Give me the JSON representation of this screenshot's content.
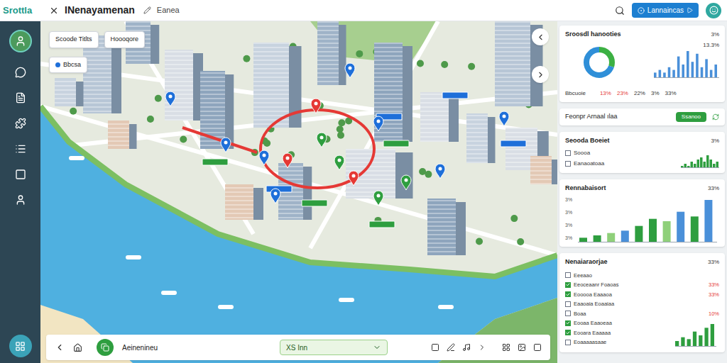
{
  "header": {
    "logo": "Srottla",
    "title": "INenayamenan",
    "subtitle": "Eanea",
    "button": "Lannaincas"
  },
  "map": {
    "chips": [
      "Scoode Titlts",
      "Hoooqore",
      "Bbcsa"
    ],
    "pins": [
      {
        "color": "#e53935"
      },
      {
        "color": "#1e6fd9"
      },
      {
        "color": "#1e6fd9"
      },
      {
        "color": "#e53935"
      },
      {
        "color": "#1e6fd9"
      },
      {
        "color": "#2e9e3f"
      },
      {
        "color": "#2e9e3f"
      },
      {
        "color": "#e53935"
      },
      {
        "color": "#2e9e3f"
      },
      {
        "color": "#1e6fd9"
      },
      {
        "color": "#1e6fd9"
      },
      {
        "color": "#2e9e3f"
      },
      {
        "color": "#1e6fd9"
      },
      {
        "color": "#1e6fd9"
      },
      {
        "color": "#1e6fd9"
      }
    ],
    "tags": [
      {
        "color": "#1e6fd9"
      },
      {
        "color": "#1e6fd9"
      },
      {
        "color": "#1e6fd9"
      },
      {
        "color": "#1e6fd9"
      },
      {
        "color": "#2e9e3f"
      },
      {
        "color": "#2e9e3f"
      },
      {
        "color": "#2e9e3f"
      },
      {
        "color": "#2e9e3f"
      }
    ]
  },
  "toolbar": {
    "label": "Aeinenineu",
    "select": "XS Inn"
  },
  "summary": {
    "title": "Sroosdl hanooties",
    "value": "3%",
    "peak": "13.3%",
    "donut": [
      {
        "value": 30,
        "color": "#3cb043"
      },
      {
        "value": 70,
        "color": "#2f8fd8"
      }
    ],
    "spark": [
      2,
      3,
      2,
      4,
      3,
      8,
      5,
      10,
      6,
      9,
      4,
      7,
      3,
      5
    ],
    "label": "Bbcuoie",
    "stats": [
      {
        "text": "13%",
        "color": "#e53935"
      },
      {
        "text": "23%",
        "color": "#e53935"
      },
      {
        "text": "22%",
        "color": "#333333"
      },
      {
        "text": "3%",
        "color": "#333333"
      },
      {
        "text": "33%",
        "color": "#333333"
      }
    ]
  },
  "filter": {
    "title": "Feonpr Arnaal ılaa",
    "button": "Ssanoo"
  },
  "checks": {
    "title": "Seooda Boeiet",
    "value": "3%",
    "items": [
      {
        "label": "Soooa",
        "checked": false
      },
      {
        "label": "Eanaoatoaa",
        "checked": false
      }
    ],
    "spark": [
      1,
      2,
      1,
      3,
      2,
      4,
      5,
      3,
      6,
      4,
      2,
      3
    ]
  },
  "report": {
    "title": "Rennabaisort",
    "value": "33%",
    "ticks": [
      "3%",
      "3%",
      "3%",
      "3%"
    ],
    "bars": [
      {
        "value": 1,
        "color": "#2e9e3f"
      },
      {
        "value": 1.5,
        "color": "#2e9e3f"
      },
      {
        "value": 2,
        "color": "#8fd07a"
      },
      {
        "value": 2.5,
        "color": "#4a90d9"
      },
      {
        "value": 3.5,
        "color": "#2e9e3f"
      },
      {
        "value": 5,
        "color": "#2e9e3f"
      },
      {
        "value": 4.5,
        "color": "#8fd07a"
      },
      {
        "value": 6.5,
        "color": "#4a90d9"
      },
      {
        "value": 5.5,
        "color": "#2e9e3f"
      },
      {
        "value": 9,
        "color": "#4a90d9"
      }
    ]
  },
  "list": {
    "title": "Nenaiaraorjae",
    "value": "33%",
    "rows": [
      {
        "label": "Eeeaao",
        "checked": false,
        "value": ""
      },
      {
        "label": "Eeoceaanr Foaoas",
        "checked": true,
        "value": "33%"
      },
      {
        "label": "Eooooa Eaaaoa",
        "checked": true,
        "value": "33%"
      },
      {
        "label": "Eaaoaia Eoaaiaa",
        "checked": false,
        "value": ""
      },
      {
        "label": "Boaa",
        "checked": false,
        "value": "10%"
      },
      {
        "label": "Eooaa Eaaoeaa",
        "checked": true,
        "value": ""
      },
      {
        "label": "Eooara Eaaaaa",
        "checked": true,
        "value": ""
      },
      {
        "label": "Eoaaaaasaae",
        "checked": false,
        "value": ""
      }
    ],
    "spark": [
      3,
      5,
      4,
      8,
      6,
      10,
      12
    ]
  }
}
